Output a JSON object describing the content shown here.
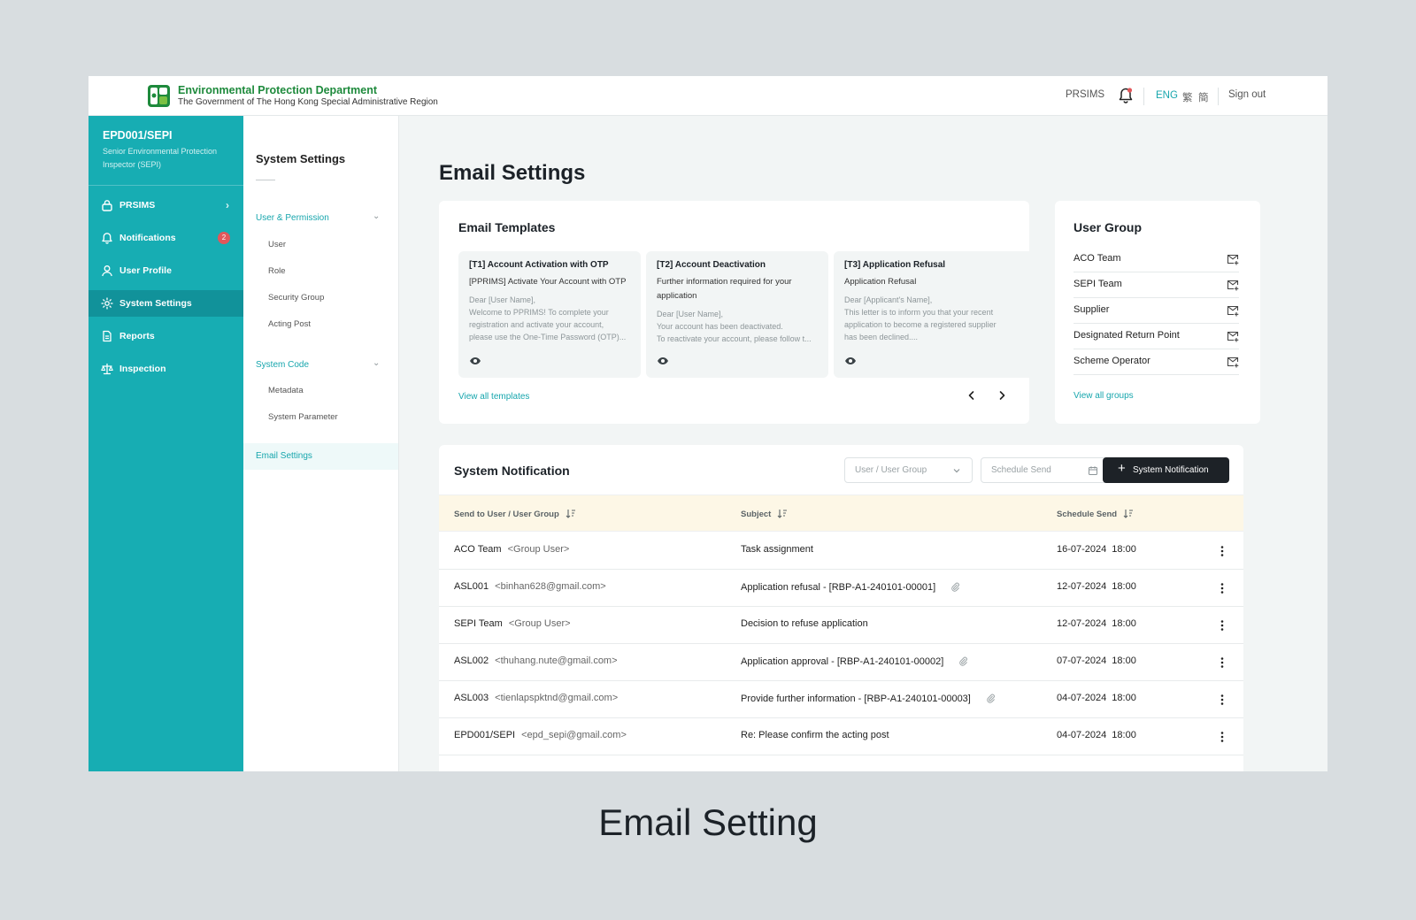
{
  "header": {
    "dept_name": "Environmental Protection Department",
    "dept_sub": "The Government of The Hong Kong Special Administrative Region",
    "app_link": "PRSIMS",
    "lang_eng": "ENG",
    "lang_trad": "繁",
    "lang_simp": "簡",
    "sign_out": "Sign out"
  },
  "user": {
    "id": "EPD001/SEPI",
    "role": "Senior Environmental Protection Inspector (SEPI)"
  },
  "sidebar": {
    "items": [
      {
        "label": "PRSIMS",
        "icon": "lock-icon"
      },
      {
        "label": "Notifications",
        "icon": "bell-icon",
        "badge": "2"
      },
      {
        "label": "User Profile",
        "icon": "user-icon"
      },
      {
        "label": "System Settings",
        "icon": "gear-icon",
        "active": true
      },
      {
        "label": "Reports",
        "icon": "document-icon"
      },
      {
        "label": "Inspection",
        "icon": "scale-icon"
      }
    ]
  },
  "submenu": {
    "title": "System Settings",
    "group1": {
      "label": "User & Permission",
      "items": [
        "User",
        "Role",
        "Security Group",
        "Acting Post"
      ]
    },
    "group2": {
      "label": "System Code",
      "items": [
        "Metadata",
        "System Parameter"
      ]
    },
    "active_item": "Email Settings"
  },
  "main": {
    "title": "Email Settings",
    "templates": {
      "title": "Email Templates",
      "cards": [
        {
          "title": "[T1] Account Activation with OTP",
          "subject": "[PPRIMS] Activate Your Account with OTP",
          "body": [
            "Dear [User Name],",
            "Welcome to PPRIMS! To complete your",
            "registration and activate your account,",
            "please use the One-Time Password (OTP)..."
          ]
        },
        {
          "title": "[T2] Account Deactivation",
          "subject": "Further information required for your application",
          "body": [
            "Dear [User Name],",
            "Your account has been deactivated.",
            "To reactivate your account, please follow t..."
          ]
        },
        {
          "title": "[T3] Application Refusal",
          "subject": "Application Refusal",
          "body": [
            "Dear [Applicant's Name],",
            "This letter is to inform you that your recent",
            "application to become a registered supplier",
            "has been declined...."
          ]
        }
      ],
      "view_all": "View all templates"
    },
    "user_group": {
      "title": "User Group",
      "items": [
        "ACO Team",
        "SEPI Team",
        "Supplier",
        "Designated Return Point",
        "Scheme Operator"
      ],
      "view_all": "View all groups"
    },
    "system_notification": {
      "title": "System Notification",
      "filter_group_placeholder": "User / User Group",
      "filter_date_placeholder": "Schedule Send",
      "add_button": "System Notification",
      "columns": [
        "Send to User / User Group",
        "Subject",
        "Schedule Send"
      ],
      "rows": [
        {
          "name": "ACO Team",
          "detail": "<Group User>",
          "subject": "Task assignment",
          "attachment": false,
          "date": "16-07-2024",
          "time": "18:00"
        },
        {
          "name": "ASL001",
          "detail": "<binhan628@gmail.com>",
          "subject": "Application refusal - [RBP-A1-240101-00001]",
          "attachment": true,
          "date": "12-07-2024",
          "time": "18:00"
        },
        {
          "name": "SEPI Team",
          "detail": "<Group User>",
          "subject": "Decision to refuse application",
          "attachment": false,
          "date": "12-07-2024",
          "time": "18:00"
        },
        {
          "name": "ASL002",
          "detail": "<thuhang.nute@gmail.com>",
          "subject": "Application approval - [RBP-A1-240101-00002]",
          "attachment": true,
          "date": "07-07-2024",
          "time": "18:00"
        },
        {
          "name": "ASL003",
          "detail": "<tienlapspktnd@gmail.com>",
          "subject": "Provide further information - [RBP-A1-240101-00003]",
          "attachment": true,
          "date": "04-07-2024",
          "time": "18:00"
        },
        {
          "name": "EPD001/SEPI",
          "detail": "<epd_sepi@gmail.com>",
          "subject": "Re: Please confirm the acting post",
          "attachment": false,
          "date": "04-07-2024",
          "time": "18:00"
        }
      ]
    }
  },
  "caption": "Email Setting",
  "colors": {
    "accent": "#17adb3",
    "brand_green": "#1e8a3c",
    "badge": "#e2575b",
    "button_dark": "#1d2227",
    "table_header": "#fdf7e6"
  }
}
